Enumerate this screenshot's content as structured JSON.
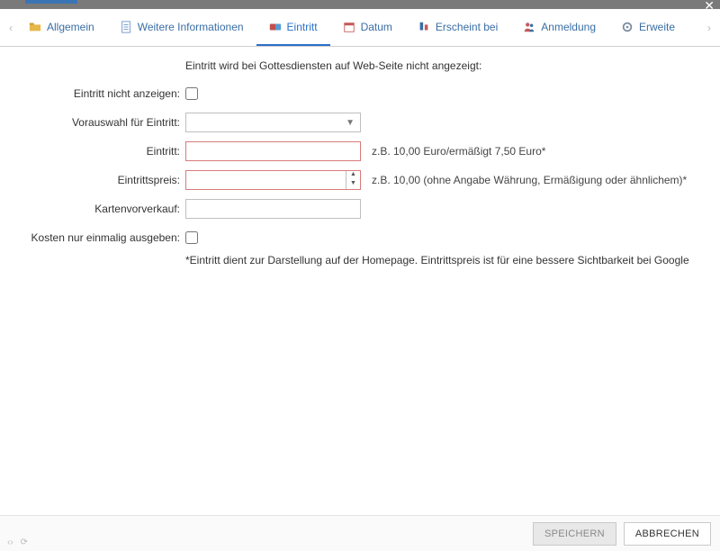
{
  "titlebar": {},
  "tabs": {
    "items": [
      {
        "label": "Allgemein",
        "icon": "folder"
      },
      {
        "label": "Weitere Informationen",
        "icon": "doc"
      },
      {
        "label": "Eintritt",
        "icon": "ticket",
        "active": true
      },
      {
        "label": "Datum",
        "icon": "calendar"
      },
      {
        "label": "Erscheint bei",
        "icon": "pin"
      },
      {
        "label": "Anmeldung",
        "icon": "people"
      },
      {
        "label": "Erweite",
        "icon": "gear"
      }
    ]
  },
  "form": {
    "intro": "Eintritt wird bei Gottesdiensten auf Web-Seite nicht angezeigt:",
    "rows": {
      "hide_entry": {
        "label": "Eintritt nicht anzeigen:",
        "value": false
      },
      "preselect": {
        "label": "Vorauswahl für Eintritt:",
        "value": ""
      },
      "entry": {
        "label": "Eintritt:",
        "value": "",
        "hint": "z.B. 10,00 Euro/ermäßigt 7,50 Euro*"
      },
      "price": {
        "label": "Eintrittspreis:",
        "value": "",
        "hint": "z.B. 10,00 (ohne Angabe Währung, Ermäßigung oder ähnlichem)*"
      },
      "presale": {
        "label": "Kartenvorverkauf:",
        "value": ""
      },
      "once": {
        "label": "Kosten nur einmalig ausgeben:",
        "value": false
      }
    },
    "footnote": "*Eintritt dient zur Darstellung auf der Homepage. Eintrittspreis ist für eine bessere Sichtbarkeit bei Google"
  },
  "footer": {
    "save_label": "SPEICHERN",
    "cancel_label": "ABBRECHEN"
  }
}
